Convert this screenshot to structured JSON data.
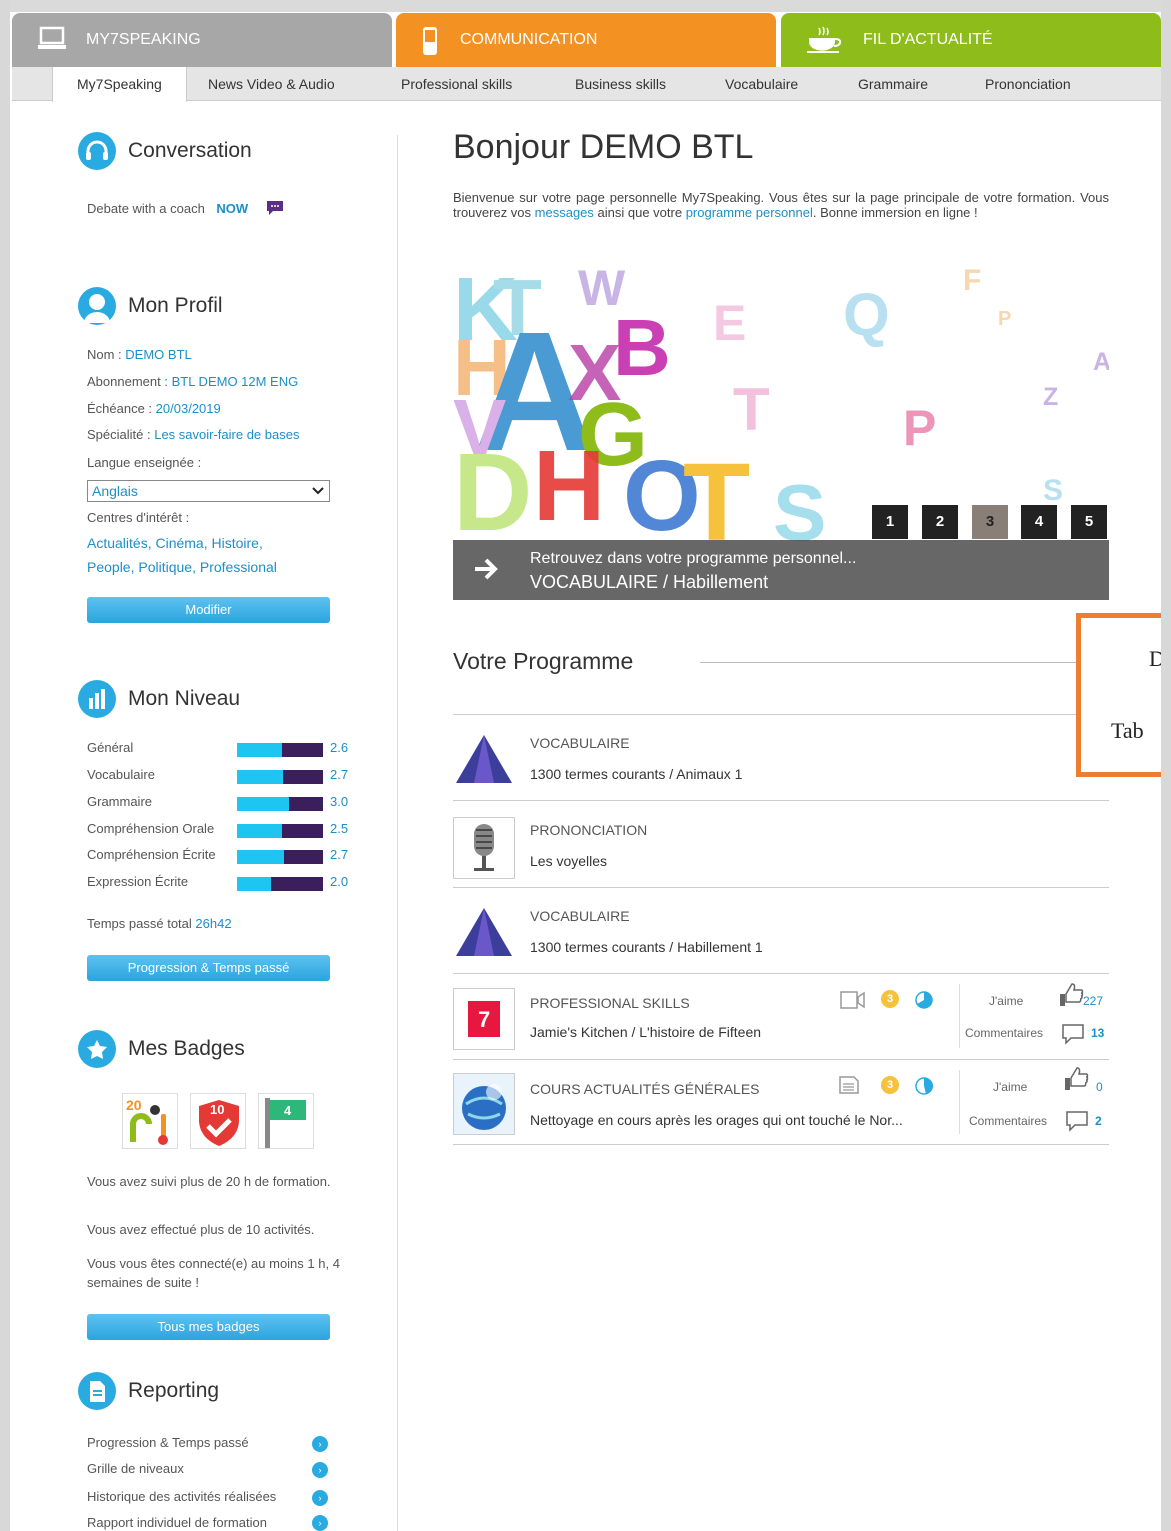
{
  "main_tabs": [
    {
      "label": "MY7SPEAKING"
    },
    {
      "label": "COMMUNICATION"
    },
    {
      "label": "FIL D'ACTUALITÉ"
    }
  ],
  "subnav": [
    {
      "label": "My7Speaking"
    },
    {
      "label": "News Video & Audio"
    },
    {
      "label": "Professional skills"
    },
    {
      "label": "Business skills"
    },
    {
      "label": "Vocabulaire"
    },
    {
      "label": "Grammaire"
    },
    {
      "label": "Prononciation"
    }
  ],
  "conversation": {
    "title": "Conversation",
    "text": "Debate with a coach",
    "now": "NOW"
  },
  "profil": {
    "title": "Mon Profil",
    "nom_label": "Nom :",
    "nom": "DEMO BTL",
    "abonnement_label": "Abonnement :",
    "abonnement": "BTL DEMO 12M ENG",
    "echeance_label": "Échéance :",
    "echeance": "20/03/2019",
    "specialite_label": "Spécialité :",
    "specialite": "Les savoir-faire de bases",
    "langue_label": "Langue enseignée :",
    "langue": "Anglais",
    "centres_label": "Centres d'intérêt :",
    "centres_line1": "Actualités,  Cinéma,  Histoire,",
    "centres_line2": "People, Politique, Professional",
    "modifier": "Modifier"
  },
  "niveau": {
    "title": "Mon Niveau",
    "levels": [
      {
        "label": "Général",
        "value": "2.6",
        "fraction": 0.52
      },
      {
        "label": "Vocabulaire",
        "value": "2.7",
        "fraction": 0.54
      },
      {
        "label": "Grammaire",
        "value": "3.0",
        "fraction": 0.6
      },
      {
        "label": "Compréhension Orale",
        "value": "2.5",
        "fraction": 0.52
      },
      {
        "label": "Compréhension Écrite",
        "value": "2.7",
        "fraction": 0.55
      },
      {
        "label": "Expression Écrite",
        "value": "2.0",
        "fraction": 0.4
      }
    ],
    "temps_label": "Temps passé total",
    "temps": "26h42",
    "button": "Progression & Temps passé"
  },
  "badges": {
    "title": "Mes Badges",
    "badge1_num": "20",
    "badge2_num": "10",
    "badge3_num": "4",
    "text1": "Vous  avez  suivi  plus  de  20  h  de formation.",
    "text2": "Vous avez effectué plus de 10 activités.",
    "text3": "Vous vous êtes connecté(e) au moins 1 h, 4 semaines de suite !",
    "button": "Tous mes badges"
  },
  "reporting": {
    "title": "Reporting",
    "items": [
      {
        "label": "Progression & Temps passé"
      },
      {
        "label": "Grille de niveaux"
      },
      {
        "label": "Historique des activités réalisées"
      },
      {
        "label": "Rapport individuel de formation"
      }
    ]
  },
  "main": {
    "greeting": "Bonjour DEMO BTL",
    "intro_a": "Bienvenue sur votre page personnelle My7Speaking. Vous êtes sur la page principale de votre formation. Vous trouverez vos ",
    "intro_link1": "messages",
    "intro_b": " ainsi que votre ",
    "intro_link2": "programme personnel",
    "intro_c": ". Bonne immersion en ligne !",
    "slides": [
      "1",
      "2",
      "3",
      "4",
      "5"
    ],
    "caption1": "Retrouvez dans votre programme personnel...",
    "caption2": "VOCABULAIRE / Habillement",
    "programme_title": "Votre Programme"
  },
  "programme": [
    {
      "cat": "VOCABULAIRE",
      "title": "1300 termes courants / Animaux 1"
    },
    {
      "cat": "PRONONCIATION",
      "title": "Les voyelles"
    },
    {
      "cat": "VOCABULAIRE",
      "title": "1300 termes courants / Habillement 1"
    },
    {
      "cat": "PROFESSIONAL SKILLS",
      "title": "Jamie's Kitchen / L'histoire de Fifteen",
      "level": "3",
      "like_label": "J'aime",
      "likes": "227",
      "comments_label": "Commentaires",
      "comments": "13",
      "thumb": "7"
    },
    {
      "cat": "COURS ACTUALITÉS GÉNÉRALES",
      "title": "Nettoyage en cours après les orages qui ont touché le Nor...",
      "level": "3",
      "like_label": "J'aime",
      "likes": "0",
      "comments_label": "Commentaires",
      "comments": "2"
    }
  ],
  "overlay": {
    "line1": "D",
    "line2": "Tab"
  },
  "colors": {
    "accent": "#29abe2",
    "tab_grey": "#a7a7a7",
    "tab_orange": "#f39222",
    "tab_green": "#8ebc1a",
    "level_dark": "#3a1f5c",
    "level_light": "#1ec5f0"
  }
}
